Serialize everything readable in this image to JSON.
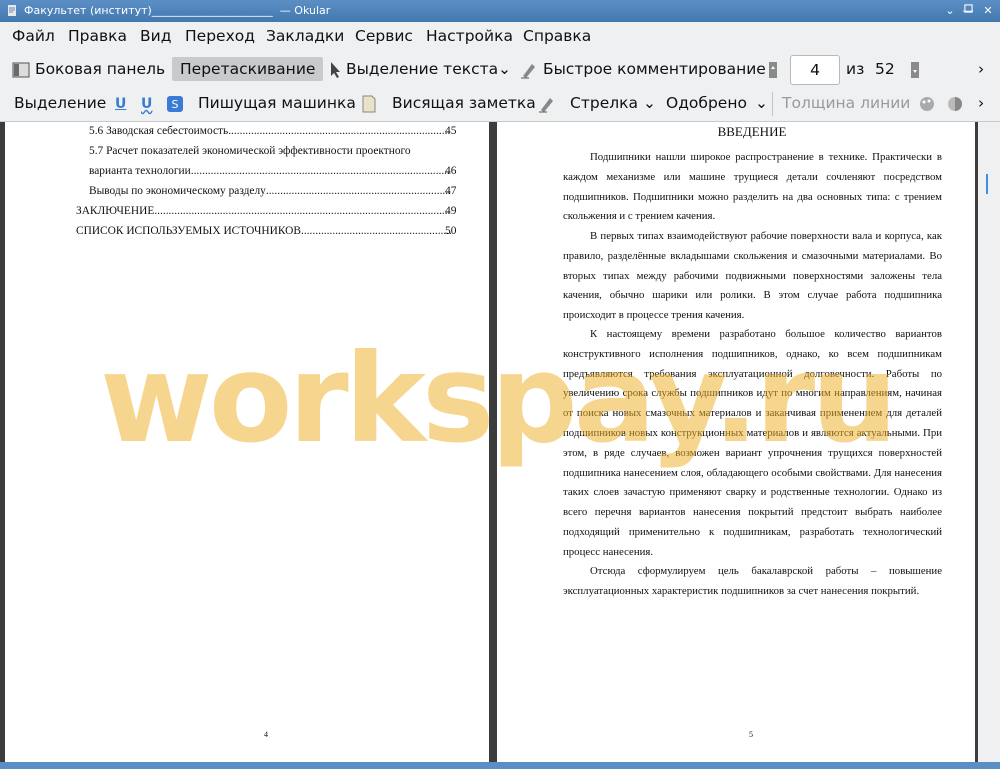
{
  "window": {
    "title": "Факультет (институт)______________________  — Okular"
  },
  "menu": [
    "Файл",
    "Правка",
    "Вид",
    "Переход",
    "Закладки",
    "Сервис",
    "Настройка",
    "Справка"
  ],
  "toolbar": {
    "sidebar": "Боковая панель",
    "drag": "Перетаскивание",
    "text_select": "Выделение текста",
    "quick_comment": "Быстрое комментирование",
    "current_page": "4",
    "of": "из",
    "total_pages": "52"
  },
  "annot_toolbar": {
    "highlight": "Выделение",
    "typewriter": "Пишущая машинка",
    "popup_note": "Висящая заметка",
    "arrow": "Стрелка",
    "stamp": "Одобрено",
    "line_width": "Толщина линии"
  },
  "left_page": {
    "toc": [
      {
        "text": "5.6 Заводская себестоимость",
        "page": "45"
      },
      {
        "text": "5.7 Расчет показателей экономической эффективности проектного",
        "page": ""
      },
      {
        "text": "варианта технологии",
        "page": "46"
      },
      {
        "text": "Выводы по экономическому разделу",
        "page": "47"
      },
      {
        "text": "ЗАКЛЮЧЕНИЕ",
        "page": "49"
      },
      {
        "text": "СПИСОК ИСПОЛЬЗУЕМЫХ ИСТОЧНИКОВ",
        "page": "50"
      }
    ],
    "page_number": "4"
  },
  "right_page": {
    "heading": "ВВЕДЕНИЕ",
    "paragraphs": [
      "Подшипники нашли широкое распространение в технике. Практически в каждом механизме или машине трущиеся детали сочленяют посредством подшипников. Подшипники можно разделить на два основных типа: с трением скольжения и с трением качения.",
      "В первых типах взаимодействуют рабочие поверхности вала и корпуса, как правило, разделённые вкладышами скольжения и смазочными материалами. Во вторых типах между рабочими подвижными поверхностями заложены тела качения, обычно шарики или ролики. В этом случае работа подшипника происходит в процессе трения качения.",
      "К настоящему времени разработано большое количество вариантов конструктивного исполнения подшипников, однако, ко всем подшипникам предъявляются требования эксплуатационной долговечности. Работы по увеличению срока службы подшипников идут по многим направлениям, начиная от поиска новых смазочных материалов и заканчивая применением для деталей подшипников новых конструкционных материалов и являются актуальными. При этом, в ряде случаев, возможен вариант упрочнения трущихся поверхностей подшипника нанесением слоя, обладающего особыми свойствами. Для нанесения таких слоев зачастую применяют сварку и родственные технологии. Однако из всего перечня вариантов нанесения покрытий предстоит выбрать наиболее подходящий применительно к подшипникам, разработать технологический процесс нанесения.",
      "Отсюда сформулируем цель бакалаврской работы – повышение эксплуатационных характеристик подшипников за счет нанесения покрытий."
    ],
    "page_number": "5"
  },
  "watermark": "workspay.ru"
}
